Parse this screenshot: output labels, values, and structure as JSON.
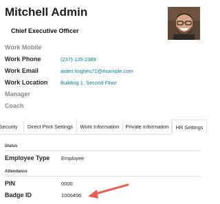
{
  "employee": {
    "name": "Mitchell Admin",
    "job_title": "Chief Executive Officer"
  },
  "contact_fields": [
    {
      "label": "Work Mobile",
      "value": ""
    },
    {
      "label": "Work Phone",
      "value": "(237)-125-2389"
    },
    {
      "label": "Work Email",
      "value": "aiden.hughes71@example.com"
    },
    {
      "label": "Work Location",
      "value": "Building 1, Second Floor"
    },
    {
      "label": "Manager",
      "value": ""
    },
    {
      "label": "Coach",
      "value": ""
    }
  ],
  "tabs": [
    {
      "label": "Security",
      "active": false
    },
    {
      "label": "Direct Print Settings",
      "active": false
    },
    {
      "label": "Work Information",
      "active": false
    },
    {
      "label": "Private Information",
      "active": false
    },
    {
      "label": "HR Settings",
      "active": true
    }
  ],
  "hr_settings": {
    "status_section": "Status",
    "employee_type_label": "Employee Type",
    "employee_type_value": "Employee",
    "attendance_section": "Attendance",
    "pin_label": "PIN",
    "pin_value": "0000",
    "badge_label": "Badge ID",
    "badge_value": "1000456"
  },
  "colors": {
    "link": "#017e84",
    "muted_label": "#8a8a8a",
    "arrow": "#e8604c"
  }
}
